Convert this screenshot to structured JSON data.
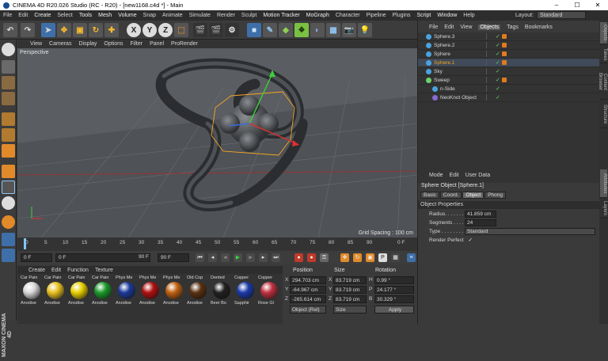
{
  "window": {
    "title": "CINEMA 4D R20.026 Studio (RC - R20) - [new1168.c4d *] - Main",
    "minimize": "–",
    "maximize": "☐",
    "close": "✕"
  },
  "menu": [
    "File",
    "Edit",
    "Create",
    "Select",
    "Tools",
    "Mesh",
    "Volume",
    "Snap",
    "Animate",
    "Simulate",
    "Render",
    "Sculpt",
    "Motion Tracker",
    "MoGraph",
    "Character",
    "Pipeline",
    "Plugins",
    "Script",
    "Window",
    "Help"
  ],
  "layout": {
    "label": "Layout:",
    "value": "Standard"
  },
  "viewport": {
    "menu": [
      "View",
      "Cameras",
      "Display",
      "Options",
      "Filter",
      "Panel",
      "ProRender"
    ],
    "label": "Perspective",
    "grid_spacing": "Grid Spacing : 100 cm"
  },
  "timeline": {
    "ticks": [
      "0",
      "5",
      "10",
      "15",
      "20",
      "25",
      "30",
      "35",
      "40",
      "45",
      "50",
      "55",
      "60",
      "65",
      "70",
      "75",
      "80",
      "85",
      "90"
    ],
    "end_label": "0 F"
  },
  "playback": {
    "current": "0 F",
    "start": "0 F",
    "end": "90 F",
    "end2": "90 F"
  },
  "materials": {
    "menu": [
      "Create",
      "Edit",
      "Function",
      "Texture"
    ],
    "items": [
      {
        "top": "Car Pain",
        "bottom": "Anodise",
        "color": "#d8d8d8"
      },
      {
        "top": "Car Pain",
        "bottom": "Anodise",
        "color": "#e8c020"
      },
      {
        "top": "Car Pain",
        "bottom": "Anodise",
        "color": "#e8d000"
      },
      {
        "top": "Car Pain",
        "bottom": "Anodise",
        "color": "#1a9a2a"
      },
      {
        "top": "Phys Me",
        "bottom": "Anodise",
        "color": "#1a3a9a"
      },
      {
        "top": "Phys Me",
        "bottom": "Anodise",
        "color": "#b01010"
      },
      {
        "top": "Phys Me",
        "bottom": "Anodise",
        "color": "#c06010"
      },
      {
        "top": "Old Cop",
        "bottom": "Anodise",
        "color": "#5a3010"
      },
      {
        "top": "Dented",
        "bottom": "Beer Bo",
        "color": "#202020"
      },
      {
        "top": "Copper",
        "bottom": "Sapphir",
        "color": "#1a3aaa"
      },
      {
        "top": "Copper",
        "bottom": "Rose Gl",
        "color": "#c03040"
      }
    ]
  },
  "coords": {
    "headers": [
      "Position",
      "Size",
      "Rotation"
    ],
    "rows": [
      {
        "axis": "X",
        "pos": "294.703 cm",
        "saxis": "X",
        "size": "83.719 cm",
        "raxis": "H",
        "rot": "0.99 °"
      },
      {
        "axis": "Y",
        "pos": "-64.967 cm",
        "saxis": "Y",
        "size": "83.719 cm",
        "raxis": "P",
        "rot": "24.177 °"
      },
      {
        "axis": "Z",
        "pos": "-265.614 cm",
        "saxis": "Z",
        "size": "83.719 cm",
        "raxis": "B",
        "rot": "30.329 °"
      }
    ],
    "mode": "Object (Rel)",
    "size_mode": "Size",
    "apply": "Apply"
  },
  "objects": {
    "menu": [
      "File",
      "Edit",
      "View",
      "Objects",
      "Tags",
      "Bookmarks"
    ],
    "active_menu": "Objects",
    "rows": [
      {
        "name": "Sphere.3",
        "color": "#4aa3e0",
        "hl": false,
        "indent": 0
      },
      {
        "name": "Sphere.2",
        "color": "#4aa3e0",
        "hl": false,
        "indent": 0
      },
      {
        "name": "Sphere",
        "color": "#4aa3e0",
        "hl": false,
        "indent": 0
      },
      {
        "name": "Sphere.1",
        "color": "#4aa3e0",
        "hl": true,
        "indent": 0
      },
      {
        "name": "Sky",
        "color": "#4aa3e0",
        "hl": false,
        "indent": 0
      },
      {
        "name": "Sweep",
        "color": "#6bd36b",
        "hl": false,
        "indent": 0
      },
      {
        "name": "n-Side",
        "color": "#4aa3e0",
        "hl": false,
        "indent": 1
      },
      {
        "name": "NeoKnot Object",
        "color": "#8a6ad0",
        "hl": false,
        "indent": 1
      }
    ]
  },
  "attributes": {
    "menu": [
      "Mode",
      "Edit",
      "User Data"
    ],
    "title": "Sphere Object [Sphere.1]",
    "tabs": [
      "Basic",
      "Coord.",
      "Object",
      "Phong"
    ],
    "active_tab": "Object",
    "section": "Object Properties",
    "radius_label": "Radius. . . . . . .",
    "radius": "41.859 cm",
    "segments_label": "Segments . . . .",
    "segments": "24",
    "type_label": "Type . . . . . . . .",
    "type": "Standard",
    "render_perfect_label": "Render Perfect",
    "render_perfect": "✓"
  },
  "side_tabs": [
    "Objects",
    "Takes",
    "Content Browser",
    "Structure",
    "Attributes",
    "Layers"
  ],
  "maxon": "MAXON CINEMA 4D"
}
